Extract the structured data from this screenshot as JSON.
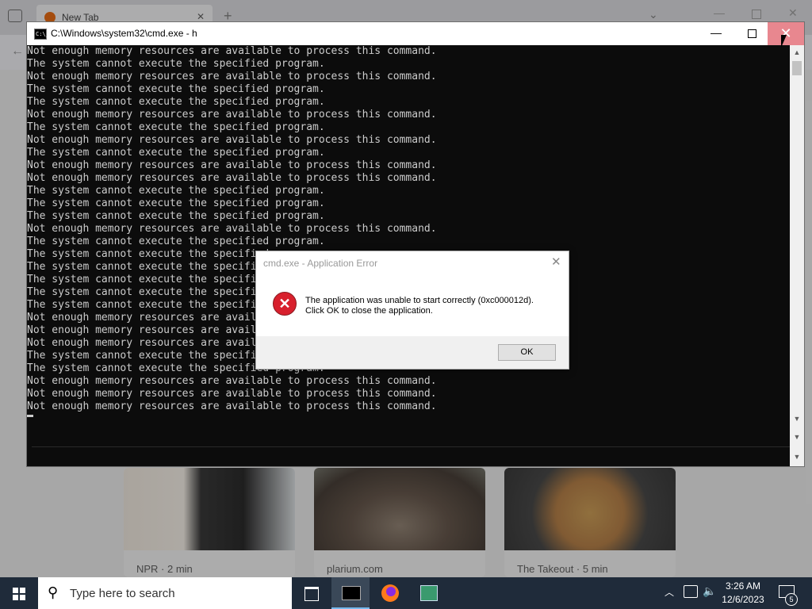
{
  "browser": {
    "tab_label": "New Tab",
    "cards": [
      {
        "source": "NPR · 2 min"
      },
      {
        "source": "plarium.com"
      },
      {
        "source": "The Takeout · 5 min"
      }
    ]
  },
  "cmd": {
    "title": "C:\\Windows\\system32\\cmd.exe - h",
    "icon_text": "C:\\_",
    "lines": [
      "Not enough memory resources are available to process this command.",
      "The system cannot execute the specified program.",
      "Not enough memory resources are available to process this command.",
      "The system cannot execute the specified program.",
      "The system cannot execute the specified program.",
      "Not enough memory resources are available to process this command.",
      "The system cannot execute the specified program.",
      "Not enough memory resources are available to process this command.",
      "The system cannot execute the specified program.",
      "Not enough memory resources are available to process this command.",
      "Not enough memory resources are available to process this command.",
      "The system cannot execute the specified program.",
      "The system cannot execute the specified program.",
      "The system cannot execute the specified program.",
      "Not enough memory resources are available to process this command.",
      "The system cannot execute the specified program.",
      "The system cannot execute the specified program.",
      "The system cannot execute the specified program.",
      "The system cannot execute the specified program.",
      "The system cannot execute the specified program.",
      "The system cannot execute the specified program.",
      "Not enough memory resources are available to process this command.",
      "Not enough memory resources are available to process this command.",
      "Not enough memory resources are available to process this command.",
      "The system cannot execute the specified program.",
      "The system cannot execute the specified program.",
      "Not enough memory resources are available to process this command.",
      "Not enough memory resources are available to process this command.",
      "Not enough memory resources are available to process this command."
    ]
  },
  "dialog": {
    "title": "cmd.exe - Application Error",
    "message_line1": "The application was unable to start correctly (0xc000012d).",
    "message_line2": "Click OK to close the application.",
    "ok_label": "OK"
  },
  "taskbar": {
    "search_placeholder": "Type here to search",
    "time": "3:26 AM",
    "date": "12/6/2023",
    "notification_count": "5"
  },
  "colors": {
    "taskbar_bg": "#1f2b3a",
    "console_bg": "#0c0c0c",
    "console_text": "#cccccc",
    "close_hover": "#e8878f",
    "error_red": "#d8202d"
  },
  "icons": {
    "window_minimize": "minimize-icon",
    "window_maximize": "maximize-icon",
    "window_close": "close-icon",
    "error": "error-icon",
    "start": "windows-logo-icon",
    "search": "search-icon"
  }
}
